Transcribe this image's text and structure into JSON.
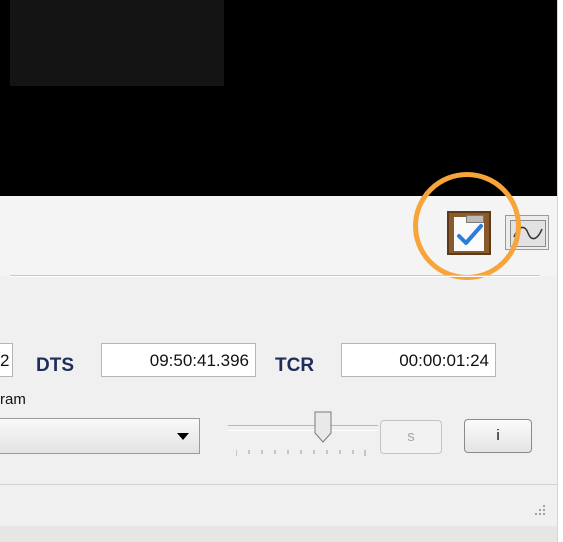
{
  "fields": {
    "prev_value": "2",
    "dts_label": "DTS",
    "dts_value": "09:50:41.396",
    "tcr_label": "TCR",
    "tcr_value": "00:00:01:24"
  },
  "program": {
    "label": "ram"
  },
  "buttons": {
    "s_label": "s",
    "i_label": "i"
  },
  "icons": {
    "checklist": "clipboard-check-icon",
    "wave": "waveform-icon",
    "dropdown": "chevron-down-icon",
    "grip": "resize-grip-icon"
  },
  "colors": {
    "highlight": "#f7a43a",
    "check": "#2e7ed8",
    "label_text": "#1f2d5a"
  },
  "slider": {
    "level": 0.6
  }
}
